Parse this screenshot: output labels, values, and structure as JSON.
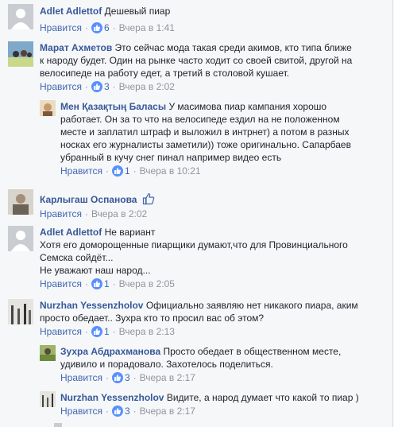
{
  "comments": [
    {
      "author": "Adlet Adlettof",
      "text": "Дешевый пиар",
      "like_label": "Нравится",
      "likes": "6",
      "time": "Вчера в 1:41"
    },
    {
      "author": "Марат Ахметов",
      "text": "Это сейчас мода такая среди акимов, кто типа ближе к народу будет. Один на рынке часто ходит со своей свитой, другой на велосипеде на работу едет, а третий в столовой кушает.",
      "like_label": "Нравится",
      "likes": "3",
      "time": "Вчера в 2:02"
    },
    {
      "author": "Мен Қазақтың Баласы",
      "text": "У масимова пиар кампания хорошо работает. Он за то что на велосипеде ездил на не положенном месте и заплатил штраф и выложил в интрнет) а потом в разных носках его журналисты заметили)) тоже оригинально. Сапарбаев убранный в кучу снег пинал например видео есть",
      "like_label": "Нравится",
      "likes": "1",
      "time": "Вчера в 10:21"
    },
    {
      "author": "Карлыгаш Оспанова",
      "text": "",
      "like_label": "Нравится",
      "time": "Вчера в 2:02"
    },
    {
      "author": "Adlet Adlettof",
      "text_lines": [
        "Не вариант",
        "Хотя его доморощенные пиарщики думают,что для Провинциального",
        "Семска сойдёт...",
        "Не уважают наш народ..."
      ],
      "like_label": "Нравится",
      "likes": "1",
      "time": "Вчера в 2:05"
    },
    {
      "author": "Nurzhan Yessenzholov",
      "text": "Официально заявляю нет никакого пиара, аким просто обедает.. Зухра кто то просил вас об этом?",
      "like_label": "Нравится",
      "likes": "1",
      "time": "Вчера в 2:13"
    },
    {
      "author": "Зухра Абдрахманова",
      "text": "Просто обедает в общественном месте, удивило и порадовало. Захотелось поделиться.",
      "like_label": "Нравится",
      "likes": "3",
      "time": "Вчера в 2:17"
    },
    {
      "author": "Nurzhan Yessenzholov",
      "text": "Видите, а народ думает что какой то пиар )",
      "like_label": "Нравится",
      "likes": "3",
      "time": "Вчера в 2:17"
    }
  ],
  "colors": {
    "link": "#365899",
    "meta": "#90949c",
    "like_blue": "#5890ff",
    "bg": "#f6f7f9"
  }
}
